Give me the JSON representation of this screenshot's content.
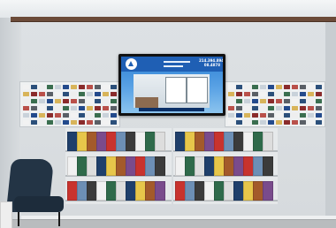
{
  "tv": {
    "phone_line1": "214.394.8944",
    "phone_line2": "08.4878"
  },
  "colors": {
    "crown_molding": "#6b4b39",
    "wall": "#d8dcdf",
    "tv_blue": "#2c7fd4",
    "chair": "#233445"
  }
}
